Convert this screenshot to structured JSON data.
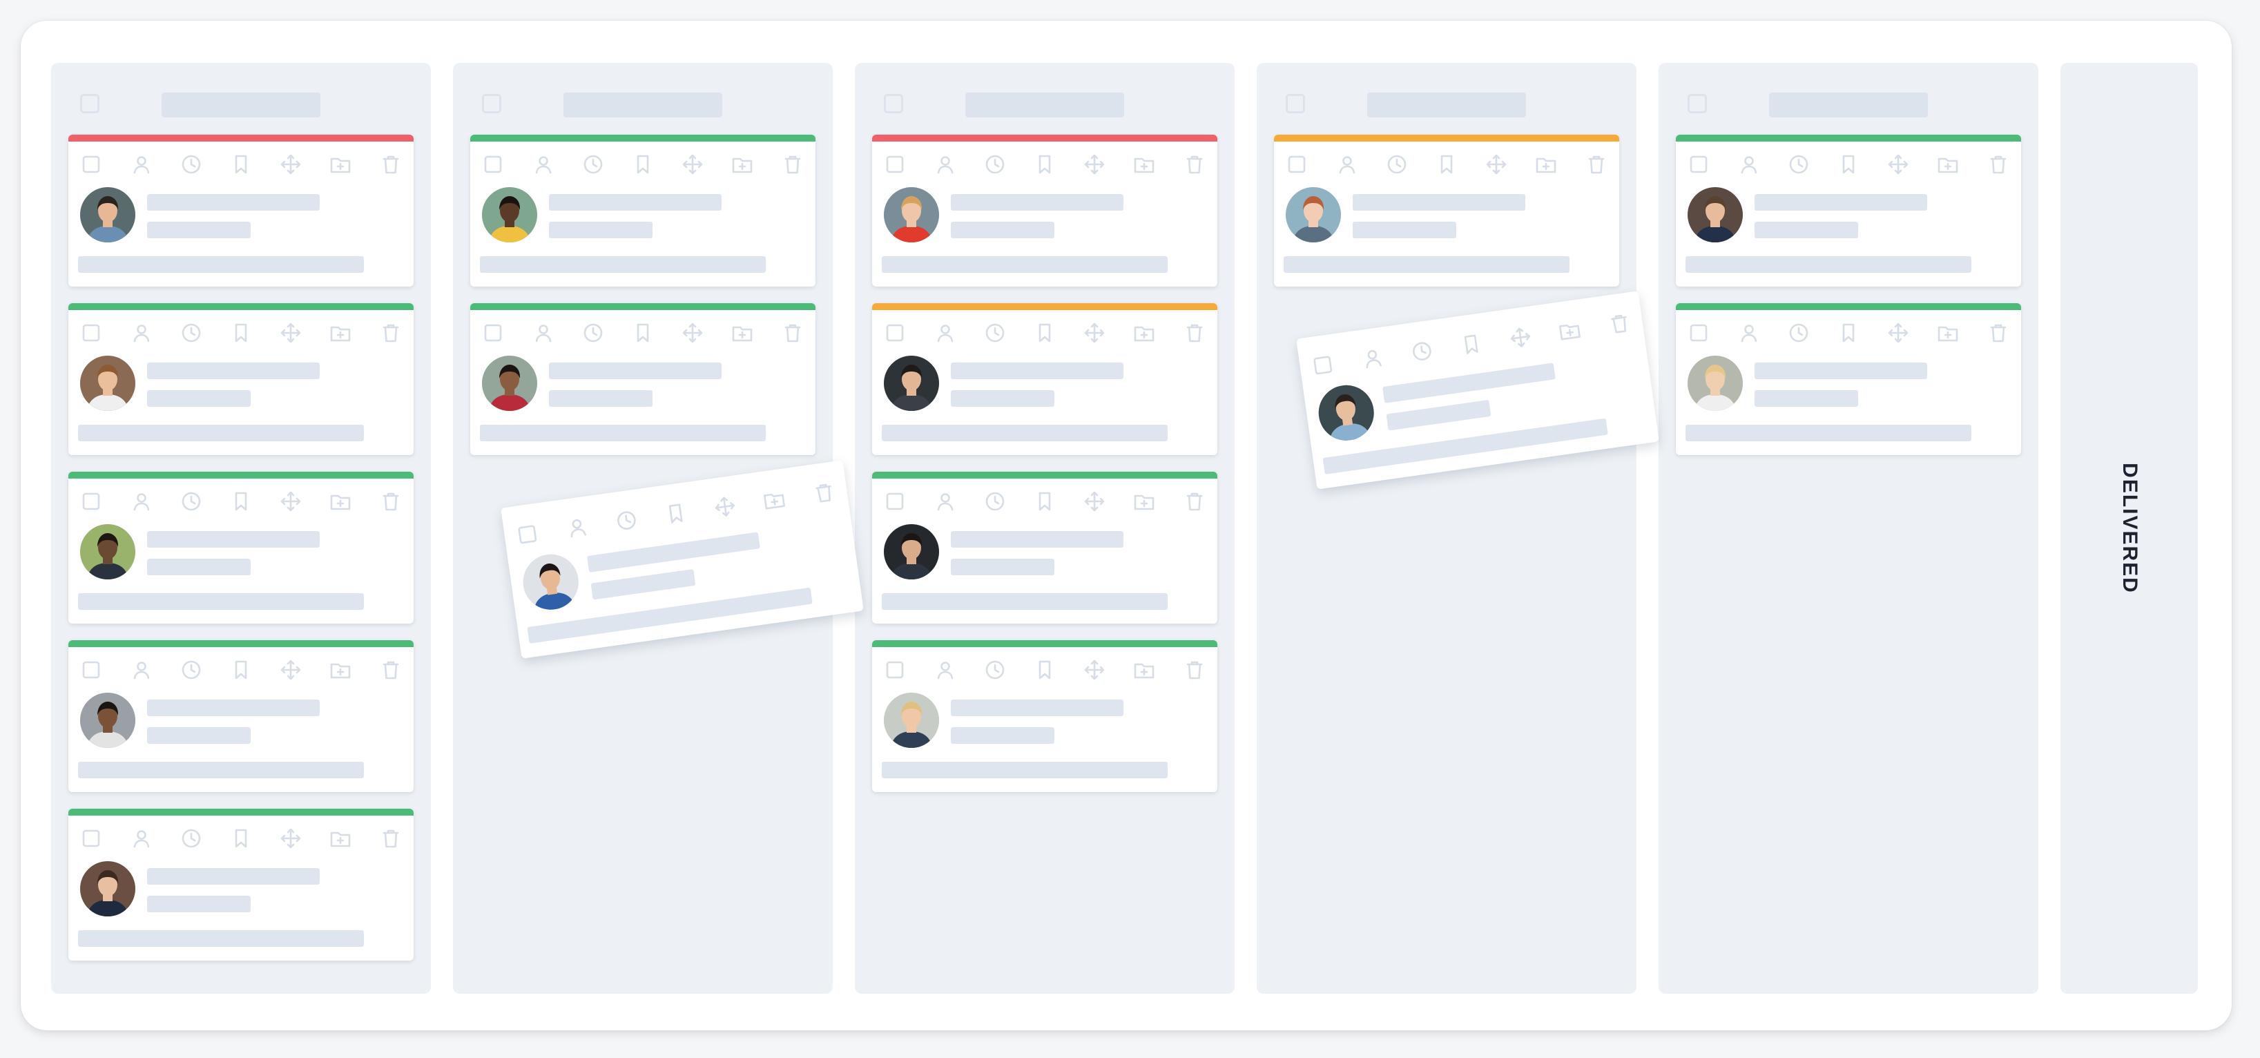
{
  "board": {
    "delivered_label": "DELIVERED",
    "colors": {
      "red": "#ef6068",
      "green": "#4dbb78",
      "orange": "#f7a93a",
      "column_bg": "#edf1f5",
      "placeholder": "#dfe5ee",
      "icon": "#d6dde7"
    },
    "card_icons": [
      "checkbox-icon",
      "user-icon",
      "clock-icon",
      "bookmark-icon",
      "move-icon",
      "folder-add-icon",
      "trash-icon"
    ],
    "columns": [
      {
        "cards": [
          {
            "status": "red",
            "avatar": "person-1"
          },
          {
            "status": "green",
            "avatar": "person-2"
          },
          {
            "status": "green",
            "avatar": "person-3"
          },
          {
            "status": "green",
            "avatar": "person-4"
          },
          {
            "status": "green",
            "avatar": "person-5"
          }
        ]
      },
      {
        "cards": [
          {
            "status": "green",
            "avatar": "person-6"
          },
          {
            "status": "green",
            "avatar": "person-7"
          }
        ]
      },
      {
        "cards": [
          {
            "status": "red",
            "avatar": "person-8"
          },
          {
            "status": "orange",
            "avatar": "person-9"
          },
          {
            "status": "green",
            "avatar": "person-10"
          },
          {
            "status": "green",
            "avatar": "person-11"
          }
        ]
      },
      {
        "cards": [
          {
            "status": "orange",
            "avatar": "person-12"
          }
        ]
      },
      {
        "cards": [
          {
            "status": "green",
            "avatar": "person-13"
          },
          {
            "status": "green",
            "avatar": "person-14"
          }
        ]
      }
    ],
    "dragging_cards": [
      {
        "avatar": "person-15",
        "over_column": 2
      },
      {
        "avatar": "person-16",
        "over_column": 4
      }
    ]
  }
}
